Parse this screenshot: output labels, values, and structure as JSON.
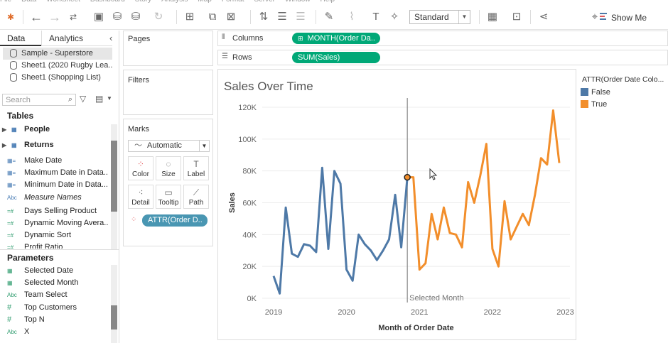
{
  "menubar": [
    "File",
    "Data",
    "Worksheet",
    "Dashboard",
    "Story",
    "Analysis",
    "Map",
    "Format",
    "Server",
    "Window",
    "Help"
  ],
  "toolbar": {
    "view_mode": "Standard",
    "show_me_label": "Show Me"
  },
  "left_panel": {
    "tabs": [
      "Data",
      "Analytics"
    ],
    "collapse_icon": "chevron-left-icon",
    "datasources": [
      "Sample - Superstore",
      "Sheet1 (2020 Rugby Lea...",
      "Sheet1 (Shopping List)"
    ],
    "search_placeholder": "Search",
    "tables_title": "Tables",
    "tables": [
      {
        "label": "People",
        "type": "table"
      },
      {
        "label": "Returns",
        "type": "table"
      },
      {
        "label": "Make Date",
        "type": "date-calc"
      },
      {
        "label": "Maximum Date in Data...",
        "type": "date-calc"
      },
      {
        "label": "Minimum Date in Data...",
        "type": "date-calc"
      },
      {
        "label": "Measure Names",
        "type": "abc"
      },
      {
        "label": "Days Selling Product",
        "type": "measure-calc"
      },
      {
        "label": "Dynamic Moving Avera...",
        "type": "measure-calc"
      },
      {
        "label": "Dynamic Sort",
        "type": "measure-calc"
      },
      {
        "label": "Profit Ratio",
        "type": "measure-calc"
      }
    ],
    "parameters_title": "Parameters",
    "parameters": [
      {
        "label": "Selected Date",
        "type": "date-param",
        "abbr": ""
      },
      {
        "label": "Selected Month",
        "type": "date-param",
        "abbr": ""
      },
      {
        "label": "Team Select",
        "type": "abc",
        "abbr": "Abc"
      },
      {
        "label": "Top Customers",
        "type": "number",
        "abbr": "#"
      },
      {
        "label": "Top N",
        "type": "number",
        "abbr": "#"
      },
      {
        "label": "X",
        "type": "abc",
        "abbr": "Abc"
      }
    ]
  },
  "cards": {
    "pages_title": "Pages",
    "filters_title": "Filters",
    "marks_title": "Marks",
    "mark_type": "Automatic",
    "mark_buttons": [
      "Color",
      "Size",
      "Label",
      "Detail",
      "Tooltip",
      "Path"
    ],
    "color_pill": "ATTR(Order D.."
  },
  "shelves": {
    "columns_label": "Columns",
    "columns_pill": "MONTH(Order Da..",
    "rows_label": "Rows",
    "rows_pill": "SUM(Sales)"
  },
  "legend": {
    "title": "ATTR(Order Date Colo...",
    "items": [
      {
        "label": "False",
        "color": "#4e79a7"
      },
      {
        "label": "True",
        "color": "#f28e2b"
      }
    ]
  },
  "chart_data": {
    "type": "line",
    "title": "Sales Over Time",
    "xlabel": "Month of Order Date",
    "ylabel": "Sales",
    "x_ticks": [
      "2019",
      "2020",
      "2021",
      "2022",
      "2023"
    ],
    "y_ticks": [
      "0K",
      "20K",
      "40K",
      "60K",
      "80K",
      "100K",
      "120K"
    ],
    "ylim": [
      0,
      120000
    ],
    "xlim": [
      "2019-01",
      "2022-12"
    ],
    "reference_line": {
      "label": "Selected Month",
      "x": "2020-11"
    },
    "highlight_point": {
      "x": "2020-11",
      "y": 76000
    },
    "series": [
      {
        "name": "False",
        "color": "#4e79a7",
        "x": [
          "2019-01",
          "2019-02",
          "2019-03",
          "2019-04",
          "2019-05",
          "2019-06",
          "2019-07",
          "2019-08",
          "2019-09",
          "2019-10",
          "2019-11",
          "2019-12",
          "2020-01",
          "2020-02",
          "2020-03",
          "2020-04",
          "2020-05",
          "2020-06",
          "2020-07",
          "2020-08",
          "2020-09",
          "2020-10",
          "2020-11"
        ],
        "y": [
          14000,
          3000,
          57000,
          28000,
          26000,
          34000,
          33000,
          29000,
          82000,
          31000,
          80000,
          72000,
          18000,
          11000,
          40000,
          34000,
          30000,
          24000,
          30000,
          37000,
          65000,
          32000,
          76000
        ]
      },
      {
        "name": "True",
        "color": "#f28e2b",
        "x": [
          "2020-11",
          "2020-12",
          "2021-01",
          "2021-02",
          "2021-03",
          "2021-04",
          "2021-05",
          "2021-06",
          "2021-07",
          "2021-08",
          "2021-09",
          "2021-10",
          "2021-11",
          "2021-12",
          "2022-01",
          "2022-02",
          "2022-03",
          "2022-04",
          "2022-05",
          "2022-06",
          "2022-07",
          "2022-08",
          "2022-09",
          "2022-10",
          "2022-11",
          "2022-12"
        ],
        "y": [
          76000,
          76000,
          18000,
          22000,
          53000,
          37000,
          57000,
          41000,
          40000,
          32000,
          73000,
          60000,
          77000,
          97000,
          31000,
          20000,
          61000,
          37000,
          45000,
          53000,
          46000,
          65000,
          88000,
          84000,
          118000,
          85000
        ]
      }
    ]
  }
}
